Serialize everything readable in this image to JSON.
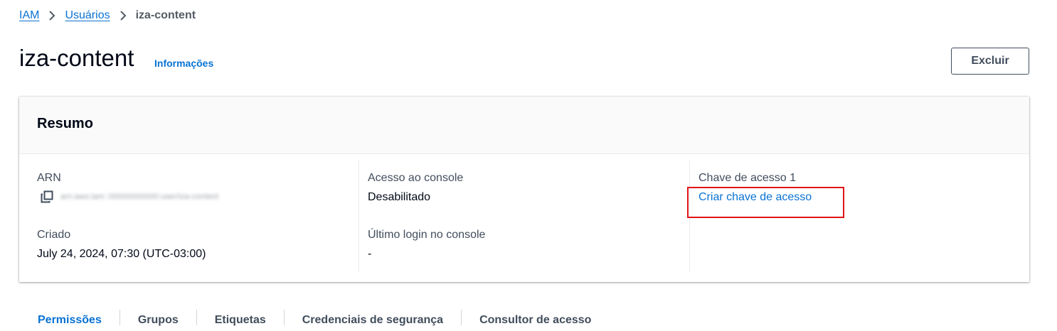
{
  "breadcrumb": {
    "items": [
      "IAM",
      "Usuários"
    ],
    "current": "iza-content"
  },
  "header": {
    "title": "iza-content",
    "info_link": "Informações",
    "delete_button": "Excluir"
  },
  "summary": {
    "title": "Resumo",
    "arn_label": "ARN",
    "arn_value": "arn:aws:iam::00000000000:user/iza-content",
    "created_label": "Criado",
    "created_value": "July 24, 2024, 07:30 (UTC-03:00)",
    "console_access_label": "Acesso ao console",
    "console_access_value": "Desabilitado",
    "last_login_label": "Último login no console",
    "last_login_value": "-",
    "access_key_label": "Chave de acesso 1",
    "access_key_link": "Criar chave de acesso"
  },
  "tabs": [
    "Permissões",
    "Grupos",
    "Etiquetas",
    "Credenciais de segurança",
    "Consultor de acesso"
  ],
  "colors": {
    "link": "#0972d3",
    "highlight": "#e01515"
  }
}
